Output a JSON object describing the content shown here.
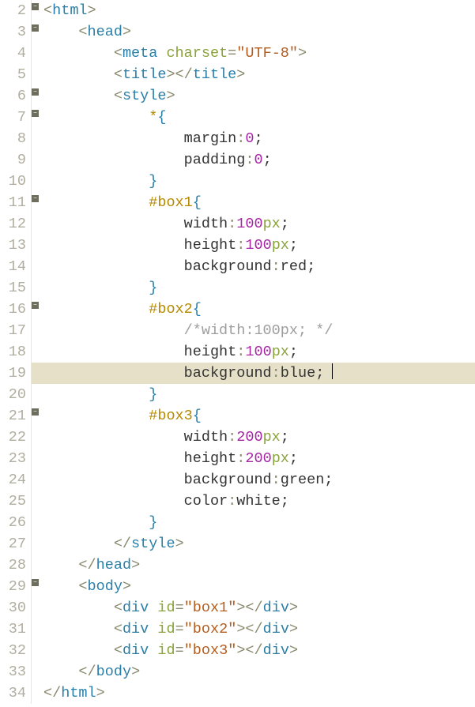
{
  "lines": [
    {
      "num": 2,
      "fold": true,
      "tokens": [
        {
          "c": "t-punc",
          "t": "<"
        },
        {
          "c": "t-tag",
          "t": "html"
        },
        {
          "c": "t-punc",
          "t": ">"
        }
      ]
    },
    {
      "num": 3,
      "fold": true,
      "tokens": [
        {
          "t": "    "
        },
        {
          "c": "t-punc",
          "t": "<"
        },
        {
          "c": "t-tag",
          "t": "head"
        },
        {
          "c": "t-punc",
          "t": ">"
        }
      ]
    },
    {
      "num": 4,
      "tokens": [
        {
          "t": "        "
        },
        {
          "c": "t-punc",
          "t": "<"
        },
        {
          "c": "t-tag",
          "t": "meta "
        },
        {
          "c": "t-attr",
          "t": "charset"
        },
        {
          "c": "t-punc",
          "t": "="
        },
        {
          "c": "t-str",
          "t": "\"UTF-8\""
        },
        {
          "c": "t-punc",
          "t": ">"
        }
      ]
    },
    {
      "num": 5,
      "tokens": [
        {
          "t": "        "
        },
        {
          "c": "t-punc",
          "t": "<"
        },
        {
          "c": "t-tag",
          "t": "title"
        },
        {
          "c": "t-punc",
          "t": "></"
        },
        {
          "c": "t-tag",
          "t": "title"
        },
        {
          "c": "t-punc",
          "t": ">"
        }
      ]
    },
    {
      "num": 6,
      "fold": true,
      "tokens": [
        {
          "t": "        "
        },
        {
          "c": "t-punc",
          "t": "<"
        },
        {
          "c": "t-tag",
          "t": "style"
        },
        {
          "c": "t-punc",
          "t": ">"
        }
      ]
    },
    {
      "num": 7,
      "fold": true,
      "tokens": [
        {
          "t": "            "
        },
        {
          "c": "t-sel",
          "t": "*"
        },
        {
          "c": "t-selbr",
          "t": "{"
        }
      ]
    },
    {
      "num": 8,
      "tokens": [
        {
          "t": "                "
        },
        {
          "c": "t-prop",
          "t": "margin"
        },
        {
          "c": "t-punc",
          "t": ":"
        },
        {
          "c": "t-num",
          "t": "0"
        },
        {
          "c": "t-semi",
          "t": ";"
        }
      ]
    },
    {
      "num": 9,
      "tokens": [
        {
          "t": "                "
        },
        {
          "c": "t-prop",
          "t": "padding"
        },
        {
          "c": "t-punc",
          "t": ":"
        },
        {
          "c": "t-num",
          "t": "0"
        },
        {
          "c": "t-semi",
          "t": ";"
        }
      ]
    },
    {
      "num": 10,
      "tokens": [
        {
          "t": "            "
        },
        {
          "c": "t-selbr",
          "t": "}"
        }
      ]
    },
    {
      "num": 11,
      "fold": true,
      "tokens": [
        {
          "t": "            "
        },
        {
          "c": "t-sel",
          "t": "#box1"
        },
        {
          "c": "t-selbr",
          "t": "{"
        }
      ]
    },
    {
      "num": 12,
      "tokens": [
        {
          "t": "                "
        },
        {
          "c": "t-prop",
          "t": "width"
        },
        {
          "c": "t-punc",
          "t": ":"
        },
        {
          "c": "t-num",
          "t": "100"
        },
        {
          "c": "t-unit",
          "t": "px"
        },
        {
          "c": "t-semi",
          "t": ";"
        }
      ]
    },
    {
      "num": 13,
      "tokens": [
        {
          "t": "                "
        },
        {
          "c": "t-prop",
          "t": "height"
        },
        {
          "c": "t-punc",
          "t": ":"
        },
        {
          "c": "t-num",
          "t": "100"
        },
        {
          "c": "t-unit",
          "t": "px"
        },
        {
          "c": "t-semi",
          "t": ";"
        }
      ]
    },
    {
      "num": 14,
      "tokens": [
        {
          "t": "                "
        },
        {
          "c": "t-prop",
          "t": "background"
        },
        {
          "c": "t-punc",
          "t": ":"
        },
        {
          "c": "t-val",
          "t": "red"
        },
        {
          "c": "t-semi",
          "t": ";"
        }
      ]
    },
    {
      "num": 15,
      "tokens": [
        {
          "t": "            "
        },
        {
          "c": "t-selbr",
          "t": "}"
        }
      ]
    },
    {
      "num": 16,
      "fold": true,
      "tokens": [
        {
          "t": "            "
        },
        {
          "c": "t-sel",
          "t": "#box2"
        },
        {
          "c": "t-selbr",
          "t": "{"
        }
      ]
    },
    {
      "num": 17,
      "tokens": [
        {
          "t": "                "
        },
        {
          "c": "t-comm",
          "t": "/*width:100px; */"
        }
      ]
    },
    {
      "num": 18,
      "tokens": [
        {
          "t": "                "
        },
        {
          "c": "t-prop",
          "t": "height"
        },
        {
          "c": "t-punc",
          "t": ":"
        },
        {
          "c": "t-num",
          "t": "100"
        },
        {
          "c": "t-unit",
          "t": "px"
        },
        {
          "c": "t-semi",
          "t": ";"
        }
      ]
    },
    {
      "num": 19,
      "hl": true,
      "tokens": [
        {
          "t": "                "
        },
        {
          "c": "t-prop",
          "t": "background"
        },
        {
          "c": "t-punc",
          "t": ":"
        },
        {
          "c": "t-val",
          "t": "blue"
        },
        {
          "c": "t-semi",
          "t": ";"
        }
      ],
      "caret": true
    },
    {
      "num": 20,
      "tokens": [
        {
          "t": "            "
        },
        {
          "c": "t-selbr",
          "t": "}"
        }
      ]
    },
    {
      "num": 21,
      "fold": true,
      "tokens": [
        {
          "t": "            "
        },
        {
          "c": "t-sel",
          "t": "#box3"
        },
        {
          "c": "t-selbr",
          "t": "{"
        }
      ]
    },
    {
      "num": 22,
      "tokens": [
        {
          "t": "                "
        },
        {
          "c": "t-prop",
          "t": "width"
        },
        {
          "c": "t-punc",
          "t": ":"
        },
        {
          "c": "t-num",
          "t": "200"
        },
        {
          "c": "t-unit",
          "t": "px"
        },
        {
          "c": "t-semi",
          "t": ";"
        }
      ]
    },
    {
      "num": 23,
      "tokens": [
        {
          "t": "                "
        },
        {
          "c": "t-prop",
          "t": "height"
        },
        {
          "c": "t-punc",
          "t": ":"
        },
        {
          "c": "t-num",
          "t": "200"
        },
        {
          "c": "t-unit",
          "t": "px"
        },
        {
          "c": "t-semi",
          "t": ";"
        }
      ]
    },
    {
      "num": 24,
      "tokens": [
        {
          "t": "                "
        },
        {
          "c": "t-prop",
          "t": "background"
        },
        {
          "c": "t-punc",
          "t": ":"
        },
        {
          "c": "t-val",
          "t": "green"
        },
        {
          "c": "t-semi",
          "t": ";"
        }
      ]
    },
    {
      "num": 25,
      "tokens": [
        {
          "t": "                "
        },
        {
          "c": "t-prop",
          "t": "color"
        },
        {
          "c": "t-punc",
          "t": ":"
        },
        {
          "c": "t-val",
          "t": "white"
        },
        {
          "c": "t-semi",
          "t": ";"
        }
      ]
    },
    {
      "num": 26,
      "tokens": [
        {
          "t": "            "
        },
        {
          "c": "t-selbr",
          "t": "}"
        }
      ]
    },
    {
      "num": 27,
      "tokens": [
        {
          "t": "        "
        },
        {
          "c": "t-punc",
          "t": "</"
        },
        {
          "c": "t-tag",
          "t": "style"
        },
        {
          "c": "t-punc",
          "t": ">"
        }
      ]
    },
    {
      "num": 28,
      "tokens": [
        {
          "t": "    "
        },
        {
          "c": "t-punc",
          "t": "</"
        },
        {
          "c": "t-tag",
          "t": "head"
        },
        {
          "c": "t-punc",
          "t": ">"
        }
      ]
    },
    {
      "num": 29,
      "fold": true,
      "tokens": [
        {
          "t": "    "
        },
        {
          "c": "t-punc",
          "t": "<"
        },
        {
          "c": "t-tag",
          "t": "body"
        },
        {
          "c": "t-punc",
          "t": ">"
        }
      ]
    },
    {
      "num": 30,
      "tokens": [
        {
          "t": "        "
        },
        {
          "c": "t-punc",
          "t": "<"
        },
        {
          "c": "t-tag",
          "t": "div "
        },
        {
          "c": "t-attr",
          "t": "id"
        },
        {
          "c": "t-punc",
          "t": "="
        },
        {
          "c": "t-str",
          "t": "\"box1\""
        },
        {
          "c": "t-punc",
          "t": "></"
        },
        {
          "c": "t-tag",
          "t": "div"
        },
        {
          "c": "t-punc",
          "t": ">"
        }
      ]
    },
    {
      "num": 31,
      "tokens": [
        {
          "t": "        "
        },
        {
          "c": "t-punc",
          "t": "<"
        },
        {
          "c": "t-tag",
          "t": "div "
        },
        {
          "c": "t-attr",
          "t": "id"
        },
        {
          "c": "t-punc",
          "t": "="
        },
        {
          "c": "t-str",
          "t": "\"box2\""
        },
        {
          "c": "t-punc",
          "t": "></"
        },
        {
          "c": "t-tag",
          "t": "div"
        },
        {
          "c": "t-punc",
          "t": ">"
        }
      ]
    },
    {
      "num": 32,
      "tokens": [
        {
          "t": "        "
        },
        {
          "c": "t-punc",
          "t": "<"
        },
        {
          "c": "t-tag",
          "t": "div "
        },
        {
          "c": "t-attr",
          "t": "id"
        },
        {
          "c": "t-punc",
          "t": "="
        },
        {
          "c": "t-str",
          "t": "\"box3\""
        },
        {
          "c": "t-punc",
          "t": "></"
        },
        {
          "c": "t-tag",
          "t": "div"
        },
        {
          "c": "t-punc",
          "t": ">"
        }
      ]
    },
    {
      "num": 33,
      "tokens": [
        {
          "t": "    "
        },
        {
          "c": "t-punc",
          "t": "</"
        },
        {
          "c": "t-tag",
          "t": "body"
        },
        {
          "c": "t-punc",
          "t": ">"
        }
      ]
    },
    {
      "num": 34,
      "tokens": [
        {
          "c": "t-punc",
          "t": "</"
        },
        {
          "c": "t-tag",
          "t": "html"
        },
        {
          "c": "t-punc",
          "t": ">"
        }
      ]
    }
  ]
}
